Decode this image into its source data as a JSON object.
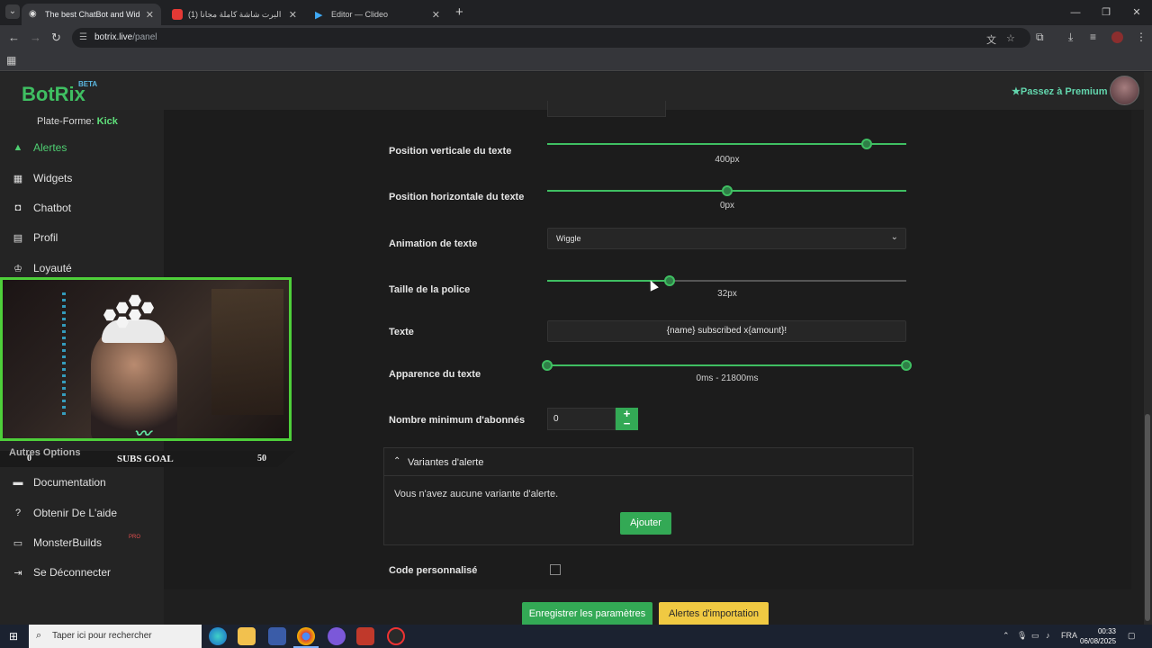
{
  "browser": {
    "tabs": [
      {
        "label": "The best ChatBot and Widgets",
        "active": true
      },
      {
        "label": "(1) البرت شاشة كاملة مجانا | Flag",
        "active": false
      },
      {
        "label": "Editor — Clideo",
        "active": false
      }
    ],
    "url_host": "botrix.live",
    "url_path": "/panel"
  },
  "app": {
    "logo": "BotRix",
    "beta": "BETA",
    "premium_label": "Passez à Premium"
  },
  "sidebar": {
    "platform_label": "Plate-Forme:",
    "platform_value": "Kick",
    "items": [
      {
        "label": "Alertes",
        "icon": "warning-icon",
        "active": true
      },
      {
        "label": "Widgets",
        "icon": "grid-icon"
      },
      {
        "label": "Chatbot",
        "icon": "robot-icon"
      },
      {
        "label": "Profil",
        "icon": "id-card-icon"
      },
      {
        "label": "Loyauté",
        "icon": "trophy-icon"
      }
    ],
    "section_title": "Autres Options",
    "other_items": [
      {
        "label": "Documentation",
        "icon": "book-icon"
      },
      {
        "label": "Obtenir De L'aide",
        "icon": "help-icon"
      },
      {
        "label": "MonsterBuilds",
        "icon": "laptop-icon"
      },
      {
        "label": "Se Déconnecter",
        "icon": "logout-icon"
      }
    ],
    "pro_tag": "PRO"
  },
  "form": {
    "vpos": {
      "label": "Position verticale du texte",
      "value": "400px",
      "fraction": 0.89
    },
    "hpos": {
      "label": "Position horizontale du texte",
      "value": "0px",
      "fraction": 0.5
    },
    "animation": {
      "label": "Animation de texte",
      "value": "Wiggle"
    },
    "fontsize": {
      "label": "Taille de la police",
      "value": "32px",
      "fraction": 0.34
    },
    "text": {
      "label": "Texte",
      "value": "{name} subscribed x{amount}!"
    },
    "appearance": {
      "label": "Apparence du texte",
      "value": "0ms - 21800ms",
      "range": [
        0,
        1
      ]
    },
    "min_subs": {
      "label": "Nombre minimum d'abonnés",
      "value": "0"
    },
    "custom_code": {
      "label": "Code personnalisé",
      "checked": false
    }
  },
  "variants": {
    "title": "Variantes d'alerte",
    "empty": "Vous n'avez aucune variante d'alerte.",
    "add_label": "Ajouter"
  },
  "actions": {
    "save": "Enregistrer les paramètres",
    "import": "Alertes d'importation"
  },
  "overlay": {
    "goal_low": "0",
    "goal_title": "SUBS GOAL",
    "goal_high": "50"
  },
  "taskbar": {
    "search_placeholder": "Taper ici pour rechercher",
    "lang": "FRA",
    "time": "00:33",
    "date": "06/08/2025"
  },
  "colors": {
    "accent": "#3fbf62",
    "import": "#f0c942"
  }
}
